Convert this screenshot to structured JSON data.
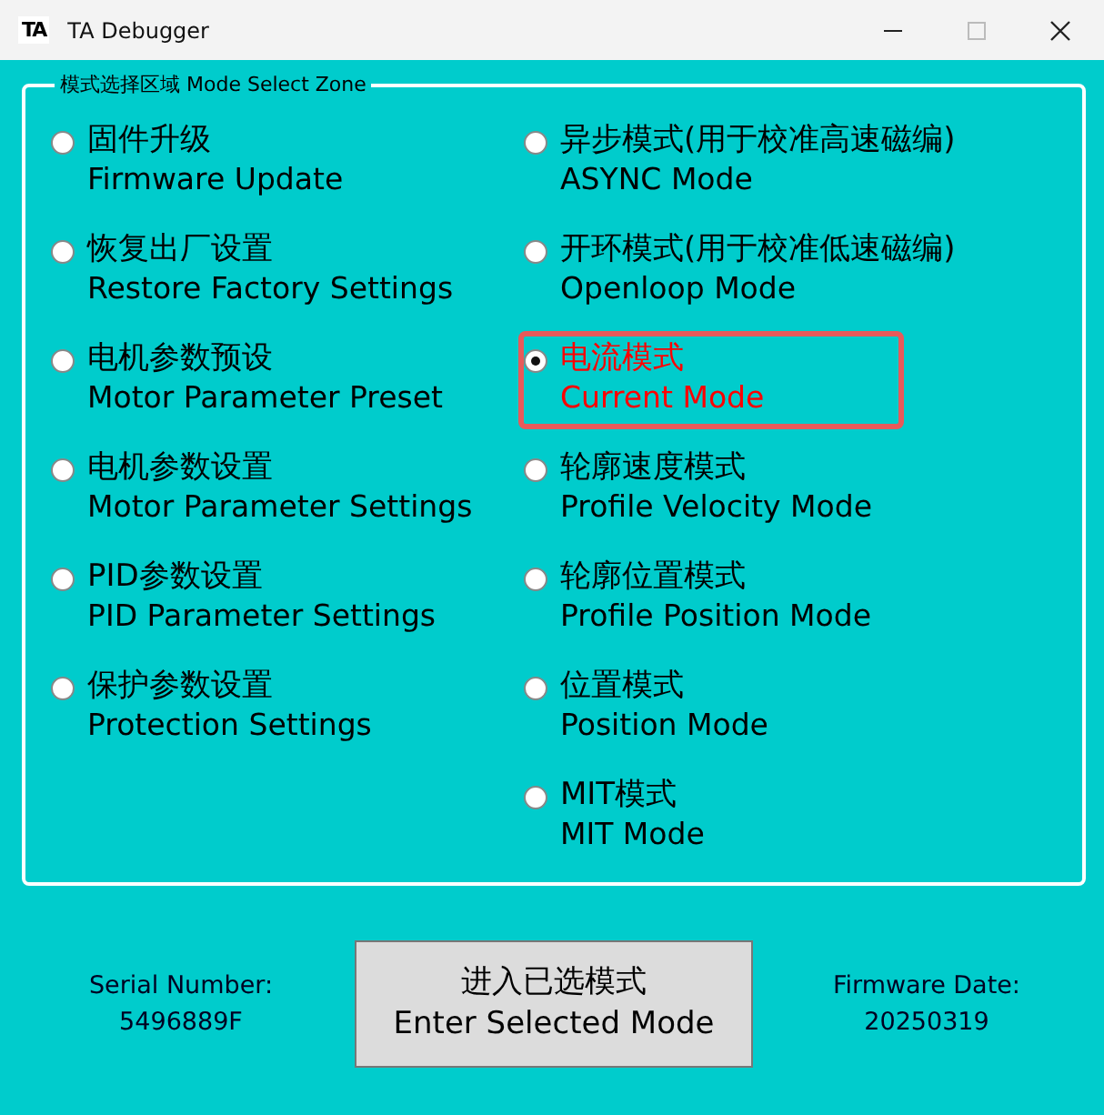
{
  "window": {
    "logo": "TA",
    "title": "TA Debugger"
  },
  "mode_select_zone": {
    "title": "模式选择区域 Mode Select Zone",
    "left_options": [
      {
        "zh": "固件升级",
        "en": "Firmware Update",
        "selected": false
      },
      {
        "zh": "恢复出厂设置",
        "en": "Restore Factory Settings",
        "selected": false
      },
      {
        "zh": "电机参数预设",
        "en": "Motor Parameter Preset",
        "selected": false
      },
      {
        "zh": "电机参数设置",
        "en": "Motor Parameter Settings",
        "selected": false
      },
      {
        "zh": "PID参数设置",
        "en": "PID Parameter Settings",
        "selected": false
      },
      {
        "zh": "保护参数设置",
        "en": "Protection Settings",
        "selected": false
      }
    ],
    "right_options": [
      {
        "zh": "异步模式(用于校准高速磁编)",
        "en": "ASYNC Mode",
        "selected": false
      },
      {
        "zh": "开环模式(用于校准低速磁编)",
        "en": "Openloop Mode",
        "selected": false
      },
      {
        "zh": "电流模式",
        "en": "Current Mode",
        "selected": true
      },
      {
        "zh": "轮廓速度模式",
        "en": "Profile Velocity Mode",
        "selected": false
      },
      {
        "zh": "轮廓位置模式",
        "en": "Profile Position Mode",
        "selected": false
      },
      {
        "zh": "位置模式",
        "en": "Position Mode",
        "selected": false
      },
      {
        "zh": "MIT模式",
        "en": "MIT Mode",
        "selected": false
      }
    ]
  },
  "serial": {
    "label": "Serial Number:",
    "value": "5496889F"
  },
  "enter_button": {
    "zh": "进入已选模式",
    "en": "Enter Selected Mode"
  },
  "firmware": {
    "label": "Firmware Date:",
    "value": "20250319"
  }
}
